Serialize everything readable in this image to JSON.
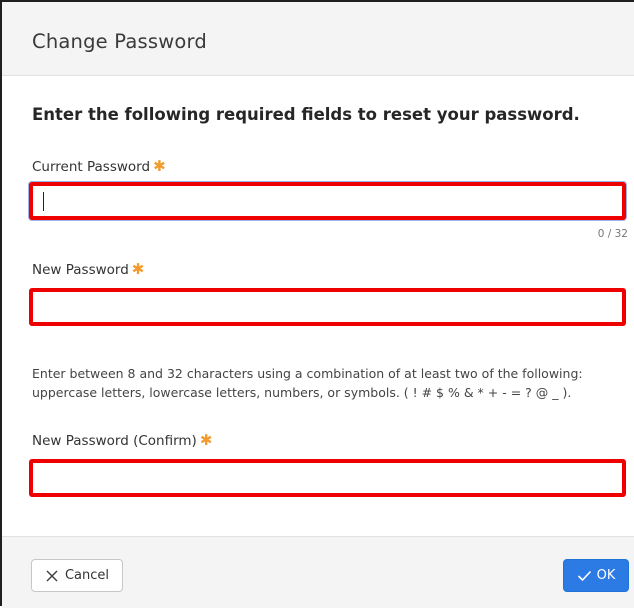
{
  "dialog": {
    "title": "Change Password",
    "instructions": "Enter the following required fields to reset your password."
  },
  "fields": {
    "current_password": {
      "label": "Current Password",
      "required_marker": "✱",
      "value": "",
      "counter": "0 / 32"
    },
    "new_password": {
      "label": "New Password",
      "required_marker": "✱",
      "value": ""
    },
    "confirm_password": {
      "label": "New Password (Confirm)",
      "required_marker": "✱",
      "value": ""
    }
  },
  "hint": "Enter between 8 and 32 characters using a combination of at least two of the following: uppercase letters, lowercase letters, numbers, or symbols. ( ! # $ % & * + - = ? @ _ ).",
  "footer": {
    "cancel_label": "Cancel",
    "ok_label": "OK"
  },
  "colors": {
    "accent": "#2c7be5",
    "required": "#f39a2c",
    "highlight": "#ee0000"
  }
}
